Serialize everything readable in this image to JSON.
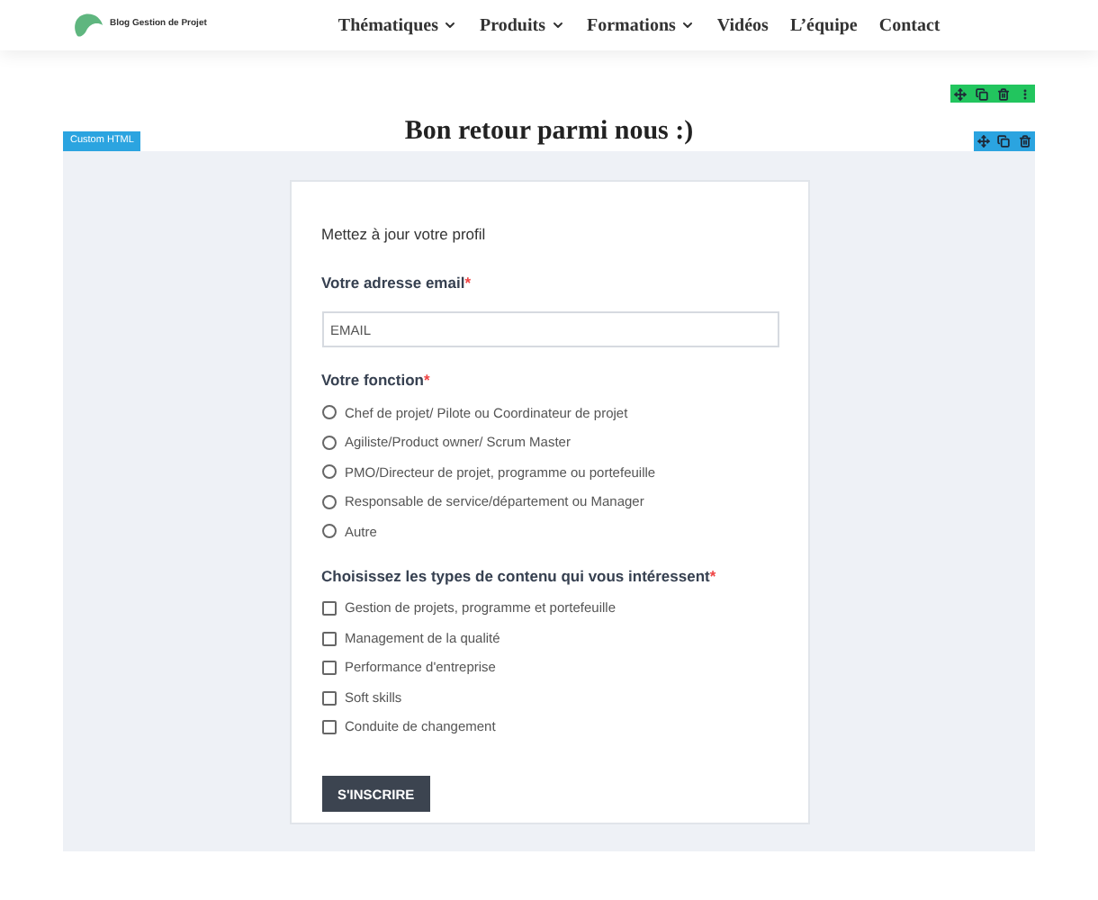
{
  "header": {
    "logo_text": "Blog Gestion de Projet",
    "nav": [
      {
        "label": "Thématiques",
        "dropdown": true
      },
      {
        "label": "Produits",
        "dropdown": true
      },
      {
        "label": "Formations",
        "dropdown": true
      },
      {
        "label": "Vidéos",
        "dropdown": false
      },
      {
        "label": "L’équipe",
        "dropdown": false
      },
      {
        "label": "Contact",
        "dropdown": false
      }
    ]
  },
  "heading": "Bon retour parmi nous :)",
  "widget_tag": "Custom HTML",
  "form": {
    "intro": "Mettez à jour votre profil",
    "email": {
      "label": "Votre adresse email",
      "required_mark": "*",
      "placeholder": "EMAIL"
    },
    "function": {
      "label": "Votre fonction",
      "required_mark": "*",
      "options": [
        {
          "label": "Chef de projet/ Pilote ou Coordinateur de projet",
          "selected": false
        },
        {
          "label": "Agiliste/Product owner/ Scrum Master",
          "selected": false
        },
        {
          "label": "PMO/Directeur de projet, programme ou portefeuille",
          "selected": false
        },
        {
          "label": "Responsable de service/département ou Manager",
          "selected": false
        },
        {
          "label": "Autre",
          "selected": false
        }
      ]
    },
    "interests": {
      "label": "Choisissez les types de contenu qui vous intéressent",
      "required_mark": "*",
      "options": [
        {
          "label": "Gestion de projets, programme et portefeuille",
          "checked": false
        },
        {
          "label": "Management de la qualité",
          "checked": false
        },
        {
          "label": "Performance d'entreprise",
          "checked": false
        },
        {
          "label": "Soft skills",
          "checked": false
        },
        {
          "label": "Conduite de changement",
          "checked": false
        }
      ]
    },
    "submit": "S'INSCRIRE"
  }
}
